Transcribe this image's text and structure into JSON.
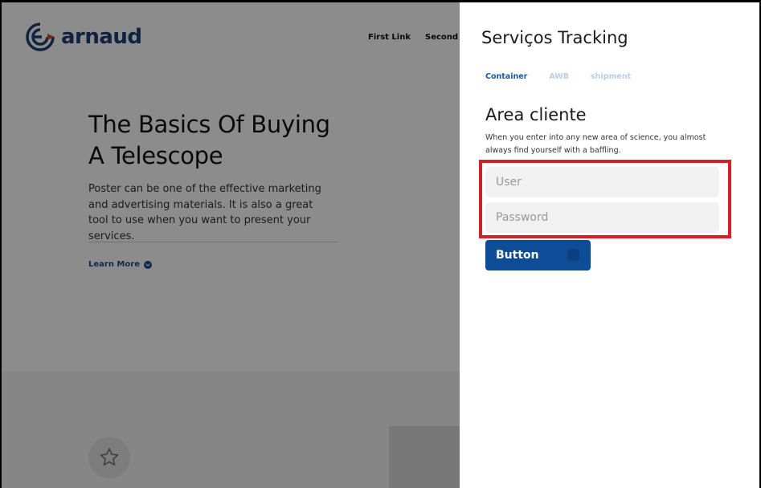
{
  "background_page": {
    "logo": {
      "text": "arnaud",
      "icon": "arnaud-logo-icon",
      "color": "#1d3f73"
    },
    "nav": {
      "first_link": "First Link",
      "second_link": "Second L"
    },
    "hero": {
      "title": "The Basics Of Buying A Telescope",
      "text": "Poster can be one of the effective marketing and advertising materials. It is also a great tool to use when you want to present your services.",
      "learn_more": "Learn More"
    },
    "feature_icon": "star-icon"
  },
  "panel": {
    "title": "Serviços Tracking",
    "tabs": [
      {
        "label": "Container",
        "active": true
      },
      {
        "label": "AWB",
        "active": false
      },
      {
        "label": "shipment",
        "active": false
      }
    ],
    "area_title": "Area cliente",
    "area_description": "When you enter into any new area of science, you almost always find yourself with a baffling.",
    "user_placeholder": "User",
    "password_placeholder": "Password",
    "button_label": "Button"
  },
  "colors": {
    "accent": "#0f4c97",
    "tab_active": "#1b5aa6",
    "tab_inactive": "#b9cde5",
    "highlight": "#d5202a"
  }
}
